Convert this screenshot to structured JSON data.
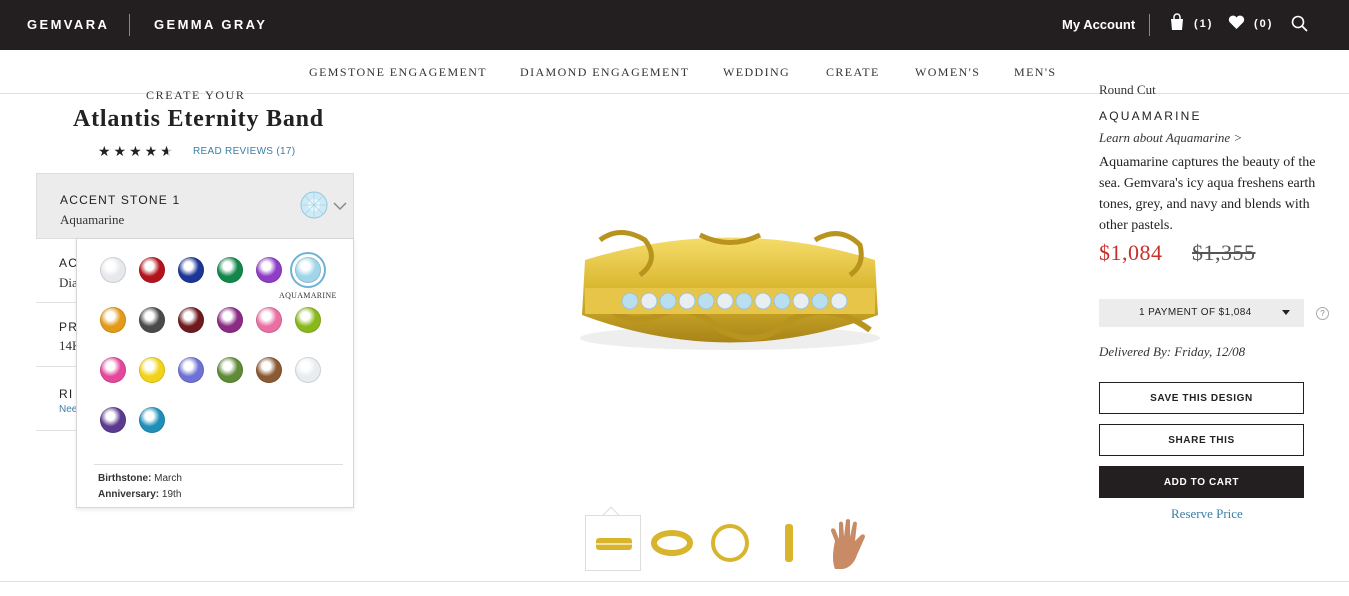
{
  "topbar": {
    "brand": "GEMVARA",
    "designer": "GEMMA GRAY",
    "my_account": "My Account",
    "cart_count": "(1)",
    "wishlist_count": "(0)",
    "icons": [
      "bag-icon",
      "heart-icon",
      "search-icon"
    ]
  },
  "nav": {
    "items": [
      "GEMSTONE ENGAGEMENT",
      "DIAMOND ENGAGEMENT",
      "WEDDING",
      "CREATE",
      "WOMEN'S",
      "MEN'S"
    ]
  },
  "product": {
    "create_your": "CREATE YOUR",
    "title": "Atlantis Eternity Band",
    "rating_stars": 4.5,
    "reviews_link": "READ REVIEWS (17)"
  },
  "options": {
    "accent_stone": {
      "label": "ACCENT STONE 1",
      "value": "Aquamarine"
    },
    "row2": {
      "label": "AC",
      "value": "Dia"
    },
    "row3": {
      "label": "PR",
      "value": "14K"
    },
    "row4": {
      "label": "RI",
      "link": "Nee"
    }
  },
  "gem_picker": {
    "selected_caption": "AQUAMARINE",
    "gems": [
      {
        "name": "diamond",
        "color": "#e6e8ec"
      },
      {
        "name": "ruby",
        "color": "#b3141c"
      },
      {
        "name": "sapphire",
        "color": "#1c3596"
      },
      {
        "name": "emerald",
        "color": "#13874a"
      },
      {
        "name": "amethyst",
        "color": "#8e3dc6"
      },
      {
        "name": "aquamarine",
        "color": "#9fd6ea"
      },
      {
        "name": "citrine",
        "color": "#e39a18"
      },
      {
        "name": "black-diamond",
        "color": "#4a4a4a"
      },
      {
        "name": "garnet",
        "color": "#6e1a1e"
      },
      {
        "name": "rhodolite",
        "color": "#8a2b86"
      },
      {
        "name": "pink-sapphire",
        "color": "#ea6fa2"
      },
      {
        "name": "peridot",
        "color": "#88b81c"
      },
      {
        "name": "pink-tourmaline",
        "color": "#e4479b"
      },
      {
        "name": "yellow-sapphire",
        "color": "#f2d31a"
      },
      {
        "name": "tanzanite",
        "color": "#6e72d4"
      },
      {
        "name": "green-tourmaline",
        "color": "#5f8a36"
      },
      {
        "name": "smoky-quartz",
        "color": "#8b5a33"
      },
      {
        "name": "white-sapphire",
        "color": "#e9ecef"
      },
      {
        "name": "alexandrite",
        "color": "#5b3b8f"
      },
      {
        "name": "blue-zircon",
        "color": "#1f8fb8"
      }
    ],
    "birthstone_label": "Birthstone:",
    "birthstone_value": "March",
    "anniversary_label": "Anniversary:",
    "anniversary_value": "19th"
  },
  "details": {
    "cut": "Round Cut",
    "stone_name": "AQUAMARINE",
    "learn_link": "Learn about Aquamarine >",
    "description": "Aquamarine captures the beauty of the sea. Gemvara's icy aqua freshens earth tones, grey, and navy and blends with other pastels.",
    "price": "$1,084",
    "old_price": "$1,355",
    "payment_option": "1 PAYMENT OF $1,084",
    "delivered": "Delivered By: Friday, 12/08",
    "save_label": "SAVE THIS DESIGN",
    "share_label": "SHARE THIS",
    "cart_label": "ADD TO CART",
    "reserve_label": "Reserve Price"
  },
  "colors": {
    "topbar": "#231f20",
    "price": "#c8312b",
    "link": "#3a7fa6",
    "gold": "#d8b52c"
  }
}
